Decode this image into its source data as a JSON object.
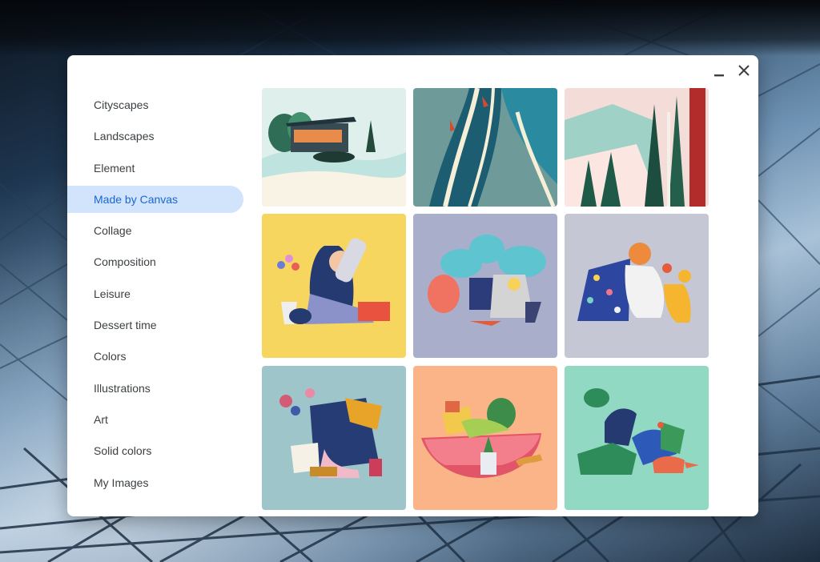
{
  "window": {
    "minimize_icon": "minimize-icon",
    "close_icon": "close-icon"
  },
  "sidebar": {
    "active_index": 3,
    "items": [
      {
        "label": "Cityscapes"
      },
      {
        "label": "Landscapes"
      },
      {
        "label": "Element"
      },
      {
        "label": "Made by Canvas"
      },
      {
        "label": "Collage"
      },
      {
        "label": "Composition"
      },
      {
        "label": "Leisure"
      },
      {
        "label": "Dessert time"
      },
      {
        "label": "Colors"
      },
      {
        "label": "Illustrations"
      },
      {
        "label": "Art"
      },
      {
        "label": "Solid colors"
      },
      {
        "label": "My Images"
      }
    ]
  },
  "wallpapers": [
    {
      "name": "house-by-lake",
      "background": "#dff0ec"
    },
    {
      "name": "river-rafting",
      "background": "#6e9a9a"
    },
    {
      "name": "pine-forest-skier",
      "background": "#f4dcd8"
    },
    {
      "name": "person-with-flowers",
      "background": "#f7d660"
    },
    {
      "name": "cat-with-plants",
      "background": "#a9aecb"
    },
    {
      "name": "person-with-dog",
      "background": "#c5c8d4"
    },
    {
      "name": "person-with-plant",
      "background": "#9ec6ca"
    },
    {
      "name": "picnic-watermelon",
      "background": "#fbb488"
    },
    {
      "name": "person-with-fox",
      "background": "#92d9c3"
    }
  ],
  "colors": {
    "accent": "#1967d2",
    "active_item_bg": "#d2e3fc",
    "text": "#3c4043"
  }
}
